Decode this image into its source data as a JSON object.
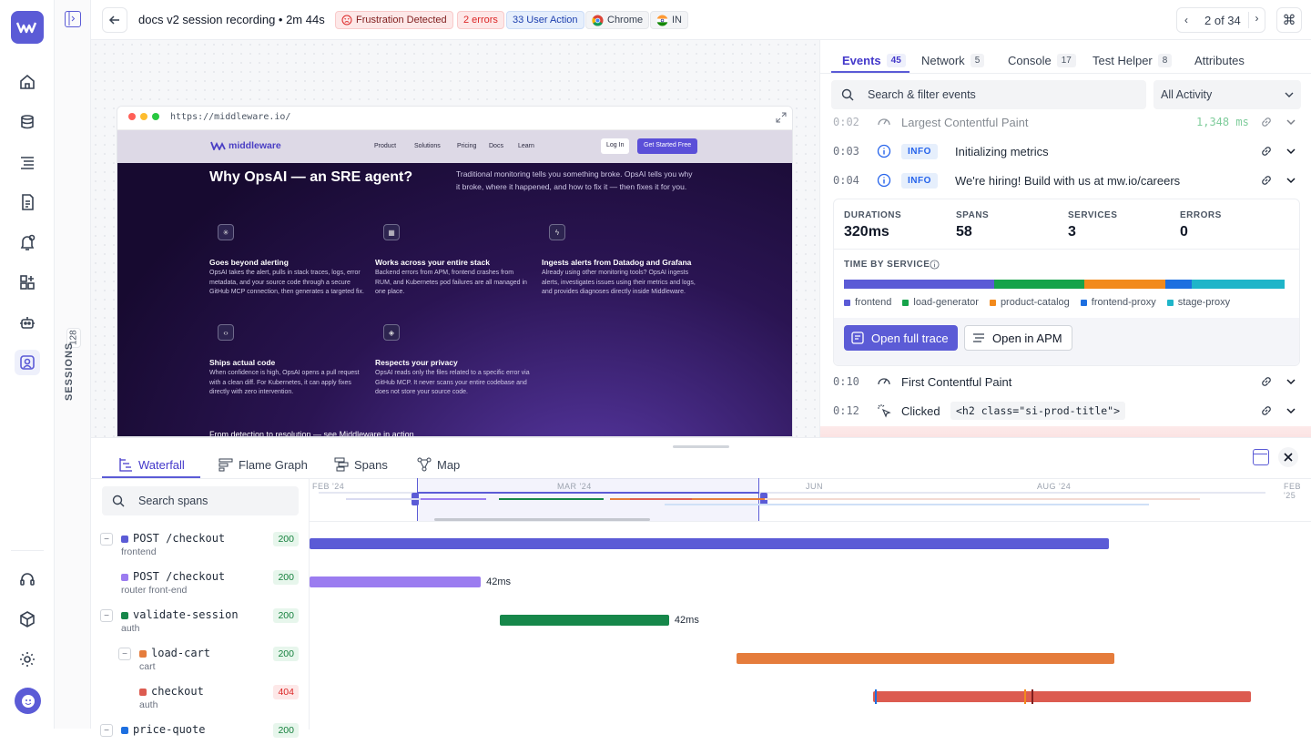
{
  "topbar": {
    "title": "docs v2 session recording • 2m 44s",
    "badges": {
      "frustration": "Frustration Detected",
      "errors": "2 errors",
      "user_action": "33 User Action",
      "browser": "Chrome",
      "country": "IN"
    },
    "pager": "2 of 34"
  },
  "sessions": {
    "label": "SESSIONS",
    "count": "128"
  },
  "replay": {
    "url": "https://middleware.io/",
    "site": {
      "brand": "middleware",
      "nav": [
        "Product",
        "Solutions",
        "Pricing",
        "Docs",
        "Learn"
      ],
      "login": "Log In",
      "cta": "Get Started Free",
      "headline": "Why OpsAI — an SRE agent?",
      "intro": "Traditional monitoring tells you something broke. OpsAI tells you why it broke, where it happened, and how to fix it — then fixes it for you.",
      "features": [
        {
          "title": "Goes beyond alerting",
          "body": "OpsAI takes the alert, pulls in stack traces, logs, error metadata, and your source code through a secure GitHub MCP connection, then generates a targeted fix."
        },
        {
          "title": "Works across your entire stack",
          "body": "Backend errors from APM, frontend crashes from RUM, and Kubernetes pod failures are all managed in one place."
        },
        {
          "title": "Ingests alerts from Datadog and Grafana",
          "body": "Already using other monitoring tools? OpsAI ingests alerts, investigates issues using their metrics and logs, and provides diagnoses directly inside Middleware."
        },
        {
          "title": "Ships actual code",
          "body": "When confidence is high, OpsAI opens a pull request with a clean diff. For Kubernetes, it can apply fixes directly with zero intervention."
        },
        {
          "title": "Respects your privacy",
          "body": "OpsAI reads only the files related to a specific error via GitHub MCP. It never scans your entire codebase and does not store your source code."
        }
      ],
      "footer_teaser": "From detection to resolution — see Middleware in action"
    }
  },
  "events_panel": {
    "tabs": [
      {
        "label": "Events",
        "count": "45"
      },
      {
        "label": "Network",
        "count": "5"
      },
      {
        "label": "Console",
        "count": "17"
      },
      {
        "label": "Test Helper",
        "count": "8"
      },
      {
        "label": "Attributes",
        "count": ""
      }
    ],
    "search_placeholder": "Search & filter events",
    "filter": "All Activity",
    "events": [
      {
        "time": "0:02",
        "text": "Largest Contentful Paint",
        "value": "1,348 ms"
      },
      {
        "time": "0:03",
        "level": "INFO",
        "text": "Initializing metrics"
      },
      {
        "time": "0:04",
        "level": "INFO",
        "text": "We're hiring! Build with us at mw.io/careers"
      },
      {
        "time": "0:10",
        "text": "First Contentful Paint"
      },
      {
        "time": "0:12",
        "text": "Clicked",
        "code": "<h2 class=\"si-prod-title\">"
      }
    ],
    "trace": {
      "stats": [
        {
          "label": "DURATIONS",
          "value": "320ms"
        },
        {
          "label": "SPANS",
          "value": "58"
        },
        {
          "label": "SERVICES",
          "value": "3"
        },
        {
          "label": "ERRORS",
          "value": "0"
        }
      ],
      "time_by_service_label": "TIME BY SERVICE",
      "services": [
        {
          "name": "frontend",
          "color": "#5b5bd6",
          "share": 0.34
        },
        {
          "name": "load-generator",
          "color": "#16a34a",
          "share": 0.205
        },
        {
          "name": "product-catalog",
          "color": "#f28a1c",
          "share": 0.185
        },
        {
          "name": "frontend-proxy",
          "color": "#1d6fe0",
          "share": 0.06
        },
        {
          "name": "stage-proxy",
          "color": "#1fb5c9",
          "share": 0.21
        }
      ],
      "open_trace": "Open full trace",
      "open_apm": "Open in APM"
    }
  },
  "bottom": {
    "tabs": [
      "Waterfall",
      "Flame Graph",
      "Spans",
      "Map"
    ],
    "search_placeholder": "Search spans",
    "months": [
      "FEB '24",
      "MAR '24",
      "JUN",
      "AUG '24",
      "FEB '25"
    ],
    "spans": [
      {
        "name": "POST /checkout",
        "service": "frontend",
        "code": "200",
        "color": "#5b5bd6",
        "toggle": "−",
        "indent": 0,
        "start": 0.0,
        "width": 0.803,
        "duration": ""
      },
      {
        "name": "POST /checkout",
        "service": "router front-end",
        "code": "200",
        "color": "#9b7cf0",
        "toggle": "",
        "indent": 0,
        "start": 0.0,
        "width": 0.172,
        "duration": "42ms"
      },
      {
        "name": "validate-session",
        "service": "auth",
        "code": "200",
        "color": "#16874a",
        "toggle": "−",
        "indent": 0,
        "start": 0.191,
        "width": 0.17,
        "duration": "42ms"
      },
      {
        "name": "load-cart",
        "service": "cart",
        "code": "200",
        "color": "#e57c3c",
        "toggle": "−",
        "indent": 1,
        "start": 0.429,
        "width": 0.379,
        "duration": ""
      },
      {
        "name": "checkout",
        "service": "auth",
        "code": "404",
        "color": "#dc5b50",
        "toggle": "",
        "indent": 1,
        "start": 0.566,
        "width": 0.379,
        "duration": ""
      },
      {
        "name": "price-quote",
        "service": "",
        "code": "200",
        "color": "#1d6fe0",
        "toggle": "−",
        "indent": 0,
        "start": 0.0,
        "width": 0.0,
        "duration": ""
      }
    ]
  }
}
